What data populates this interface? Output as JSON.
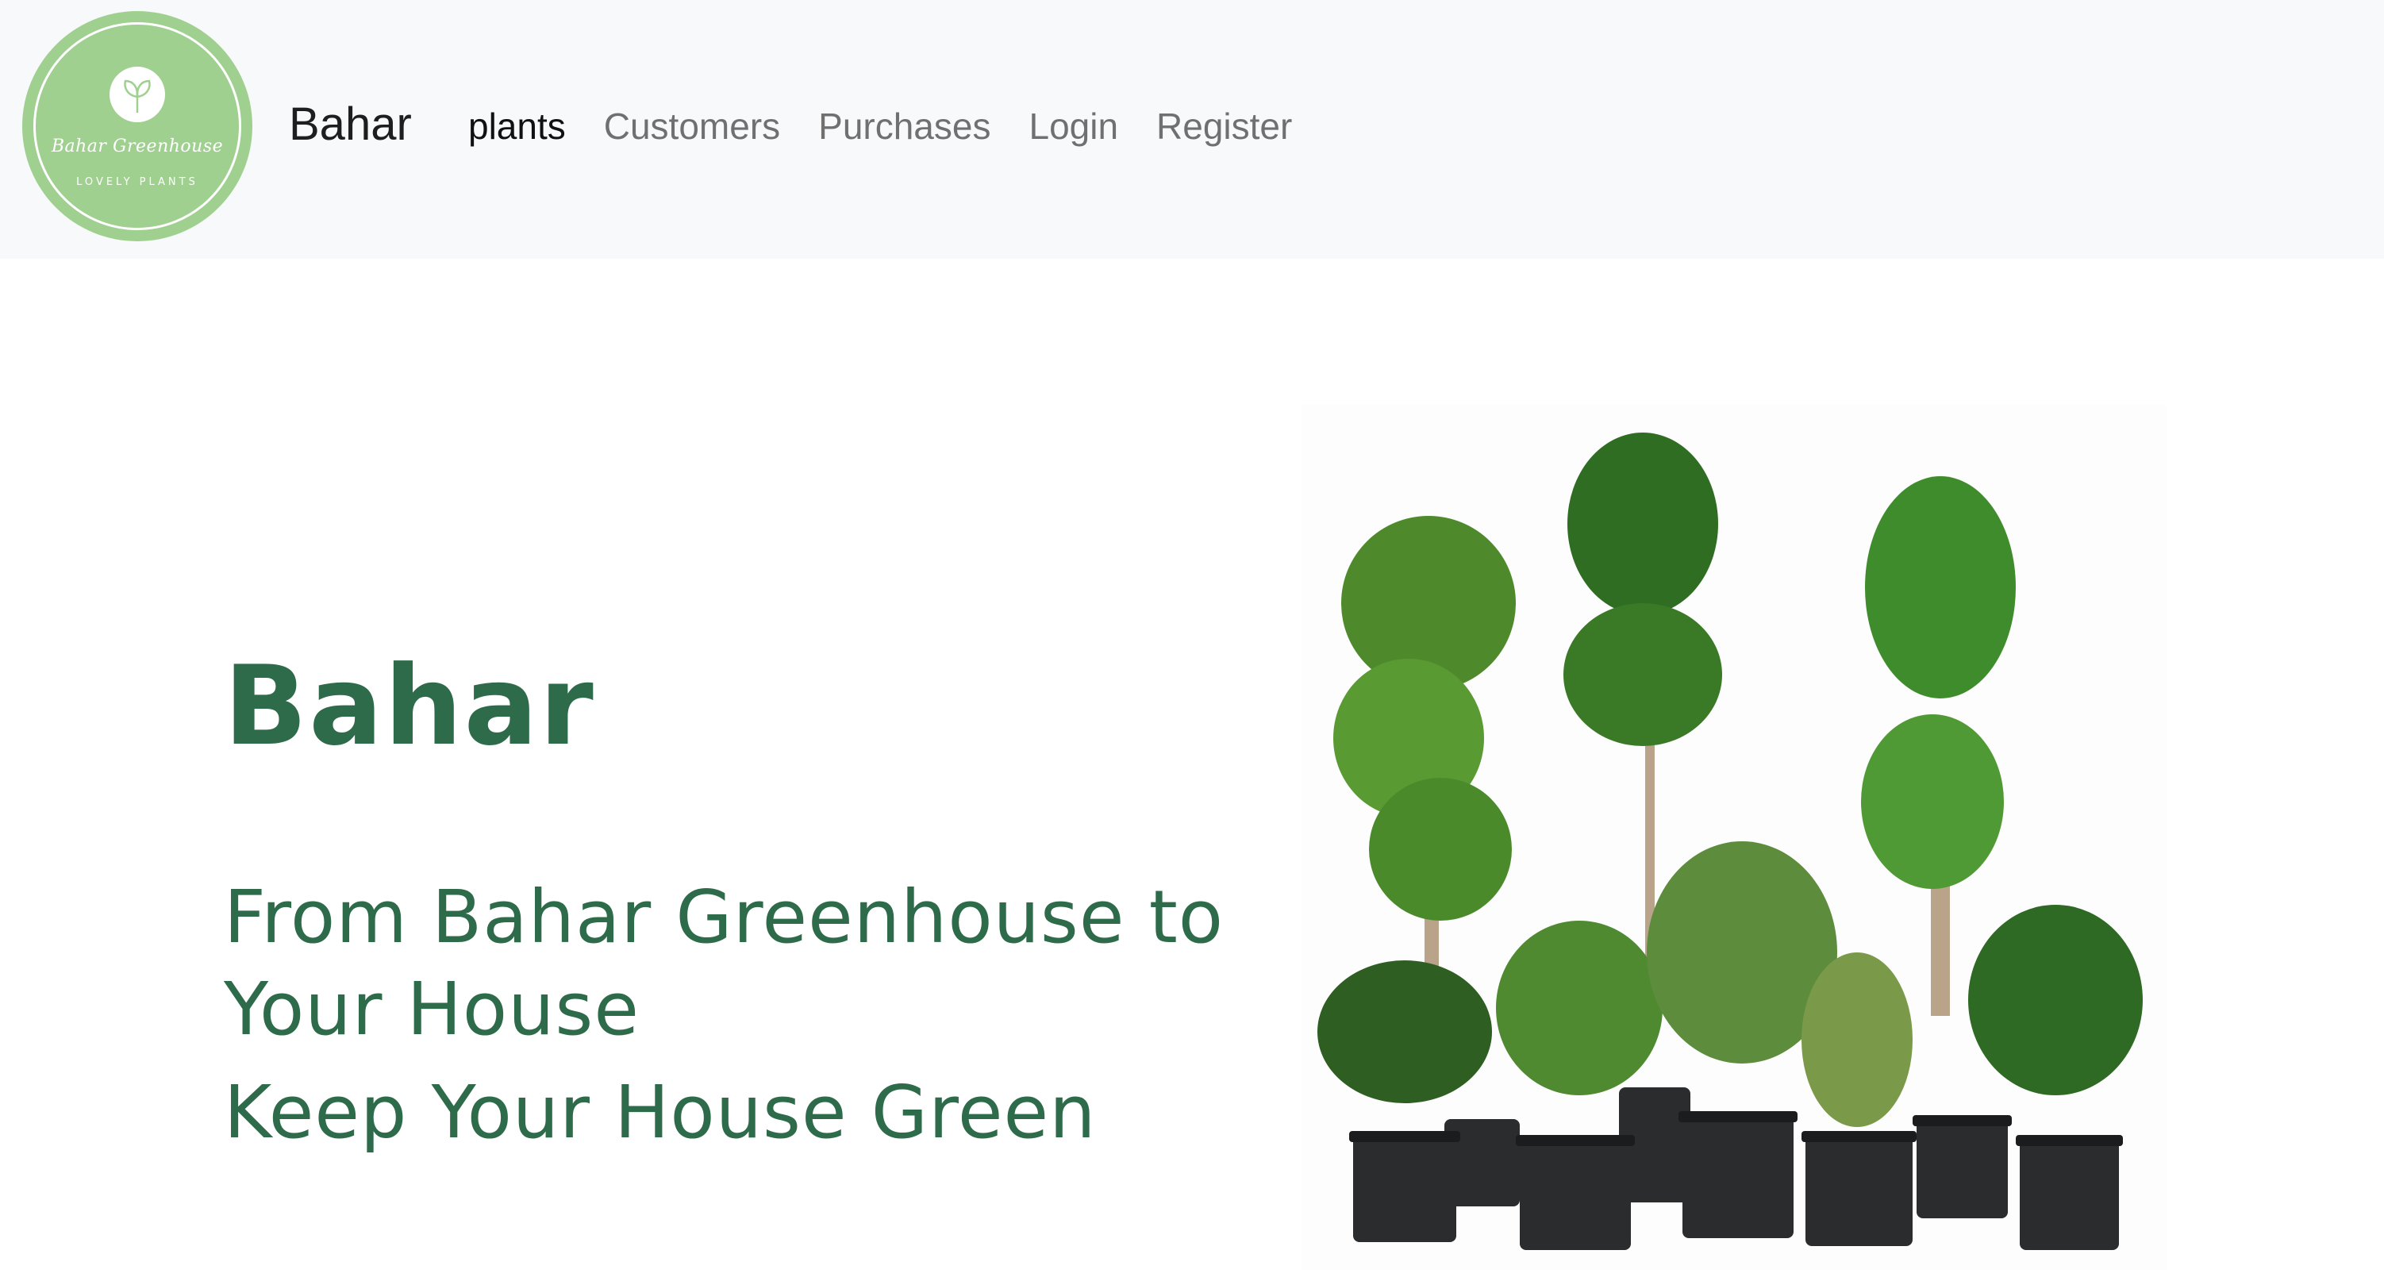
{
  "navbar": {
    "logo": {
      "name": "Bahar Greenhouse",
      "tagline": "LOVELY PLANTS",
      "icon": "leaf-icon",
      "background_color": "#9fd08f"
    },
    "brand": "Bahar",
    "links": [
      {
        "label": "plants",
        "active": true
      },
      {
        "label": "Customers",
        "active": false
      },
      {
        "label": "Purchases",
        "active": false
      },
      {
        "label": "Login",
        "active": false
      },
      {
        "label": "Register",
        "active": false
      }
    ]
  },
  "hero": {
    "title": "Bahar",
    "subtitle": "From Bahar Greenhouse to Your House",
    "tagline": "Keep Your House Green",
    "image_alt": "potted-plants-image",
    "accent_color": "#2e6b4a"
  }
}
